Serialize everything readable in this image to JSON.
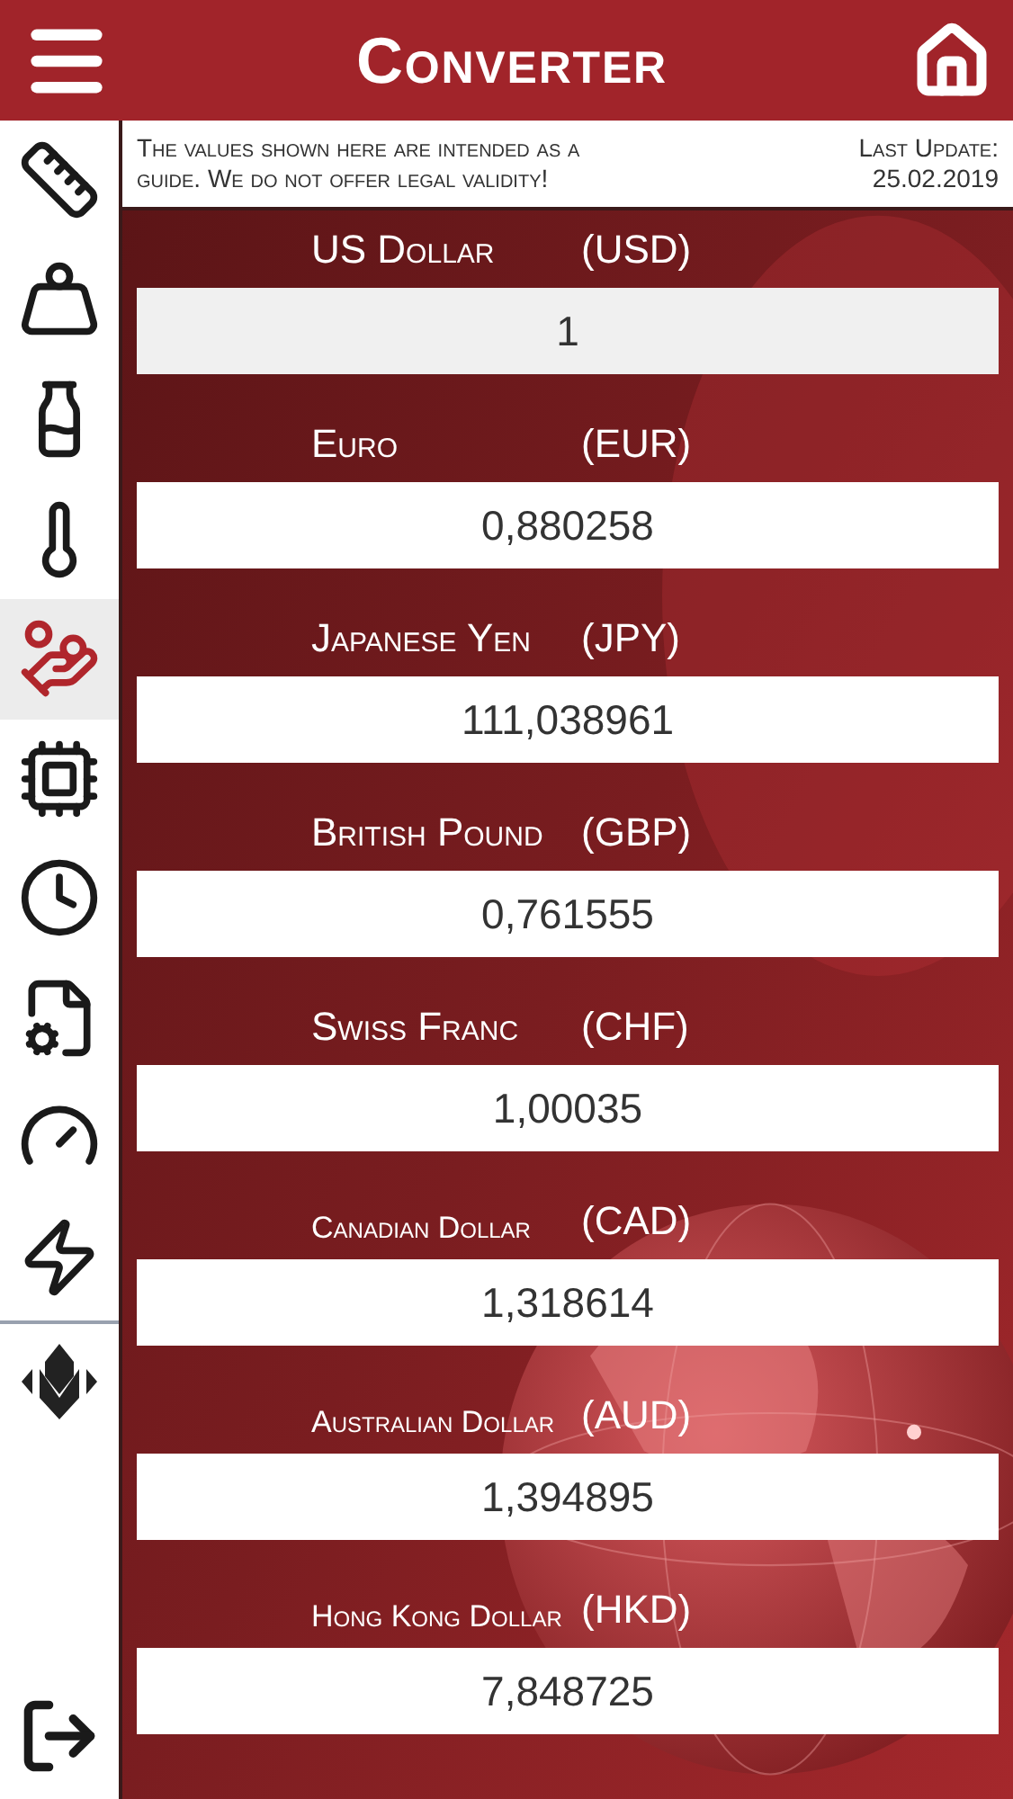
{
  "header": {
    "title": "Converter"
  },
  "sidebar": {
    "items": [
      {
        "kind": "ruler",
        "selected": false
      },
      {
        "kind": "weight",
        "selected": false
      },
      {
        "kind": "jug",
        "selected": false
      },
      {
        "kind": "thermometer",
        "selected": false
      },
      {
        "kind": "coins",
        "selected": true
      },
      {
        "kind": "chip",
        "selected": false
      },
      {
        "kind": "clock",
        "selected": false
      },
      {
        "kind": "data",
        "selected": false
      },
      {
        "kind": "gauge",
        "selected": false
      },
      {
        "kind": "bolt",
        "selected": false
      }
    ]
  },
  "notice": {
    "text": "The values shown here are intended as a guide. We do not offer legal validity!",
    "update_label": "Last Update:",
    "update_date": "25.02.2019"
  },
  "currencies": [
    {
      "name": "US Dollar",
      "code": "(USD)",
      "value": "1",
      "base": true
    },
    {
      "name": "Euro",
      "code": "(EUR)",
      "value": "0,880258",
      "base": false
    },
    {
      "name": "Japanese Yen",
      "code": "(JPY)",
      "value": "111,038961",
      "base": false
    },
    {
      "name": "British Pound",
      "code": "(GBP)",
      "value": "0,761555",
      "base": false
    },
    {
      "name": "Swiss Franc",
      "code": "(CHF)",
      "value": "1,00035",
      "base": false
    },
    {
      "name": "Canadian Dollar",
      "code": "(CAD)",
      "value": "1,318614",
      "base": false,
      "small": true
    },
    {
      "name": "Australian Dollar",
      "code": "(AUD)",
      "value": "1,394895",
      "base": false,
      "small": true
    },
    {
      "name": "Hong Kong Dollar",
      "code": "(HKD)",
      "value": "7,848725",
      "base": false,
      "small": true
    }
  ]
}
